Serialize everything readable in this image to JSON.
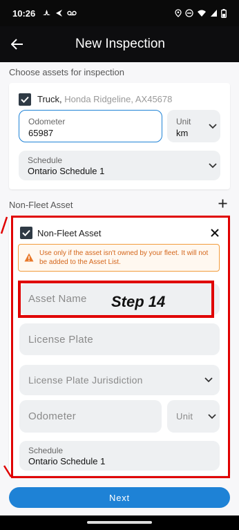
{
  "status": {
    "time": "10:26"
  },
  "appbar": {
    "title": "New Inspection"
  },
  "choose_label": "Choose assets for inspection",
  "truck": {
    "name": "Truck,",
    "details": " Honda Ridgeline, AX45678",
    "odometer_label": "Odometer",
    "odometer_value": "65987",
    "unit_label": "Unit",
    "unit_value": "km",
    "schedule_label": "Schedule",
    "schedule_value": "Ontario Schedule 1"
  },
  "non_fleet": {
    "section_label": "Non-Fleet Asset",
    "card_label": "Non-Fleet Asset",
    "warning": "Use only if the asset isn't owned by your fleet. It will not be added to the Asset List.",
    "asset_name_placeholder": "Asset Name",
    "license_plate_placeholder": "License Plate",
    "jurisdiction_placeholder": "License Plate Jurisdiction",
    "odometer_placeholder": "Odometer",
    "unit_placeholder": "Unit",
    "schedule_label": "Schedule",
    "schedule_value": "Ontario Schedule 1"
  },
  "annotation": {
    "step": "Step 14"
  },
  "next_button": "Next",
  "colors": {
    "accent": "#1e82d6",
    "warning": "#f29b3b",
    "annotation": "#e00000"
  }
}
